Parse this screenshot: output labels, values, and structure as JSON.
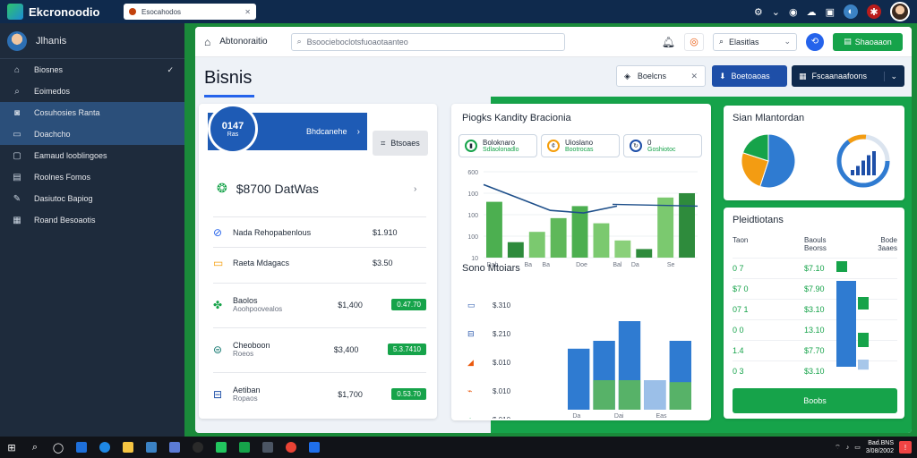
{
  "app": {
    "name": "Ekcronoodio",
    "address_tab": "Esocahodos",
    "title_icons": [
      "gear-icon",
      "chevron-down-icon",
      "help-icon",
      "cloud-icon",
      "folder-icon",
      "theme-icon",
      "grid-icon"
    ]
  },
  "sidebar": {
    "user_name": "Jlhanis",
    "items": [
      {
        "label": "Biosnes",
        "icon": "home-icon",
        "active": false,
        "check": "✓"
      },
      {
        "label": "Eoimedos",
        "icon": "search-icon",
        "active": false
      },
      {
        "label": "Cosuhosies Ranta",
        "icon": "camera-icon",
        "active": true
      },
      {
        "label": "Doachcho",
        "icon": "card-icon",
        "active": true
      },
      {
        "label": "Eamaud looblingoes",
        "icon": "monitor-icon",
        "active": false
      },
      {
        "label": "Roolnes Fomos",
        "icon": "document-icon",
        "active": false
      },
      {
        "label": "Dasiutoc Bapiog",
        "icon": "edit-icon",
        "active": false
      },
      {
        "label": "Roand Besoaotis",
        "icon": "table-icon",
        "active": false
      }
    ]
  },
  "topbar": {
    "breadcrumb": "Abtonoraitio",
    "search_placeholder": "Bsoocieboclotsfuoaotaanteo",
    "select_value": "Elasitlas",
    "action_label": "Shaoaaon"
  },
  "header": {
    "title": "Bisnis",
    "chip_label": "Boelcns",
    "button1_label": "Boetoaoas",
    "button2_label": "Fscaanaafoons"
  },
  "account_card": {
    "badge_value": "0147",
    "badge_sub": "Ras",
    "banner_label": "Bhdcanehe",
    "side_button": "Btsoaes",
    "total_label": "$8700 DatWas",
    "rows": [
      {
        "name": "Nada Rehopabenlous",
        "sub": "",
        "value": "$1.910",
        "pill": "",
        "icon": "link-icon",
        "color": "#2563eb"
      },
      {
        "name": "Raeta Mdagacs",
        "sub": "",
        "value": "$3.50",
        "pill": "",
        "icon": "card-icon",
        "color": "#f59e0b"
      },
      {
        "name": "Baolos",
        "sub": "Aoohpoovealos",
        "value": "$1,400",
        "pill": "0.47.70",
        "icon": "clover-icon",
        "color": "#16a34a"
      },
      {
        "name": "Cheoboon",
        "sub": "Roeos",
        "value": "$3,400",
        "pill": "5.3.7410",
        "icon": "wallet-icon",
        "color": "#0f766e"
      },
      {
        "name": "Aetiban",
        "sub": "Ropaos",
        "value": "$1,700",
        "pill": "0.53.70",
        "icon": "bank-icon",
        "color": "#1e4fa8"
      }
    ]
  },
  "performance_card": {
    "title": "Piogks Kandity Bracionia",
    "chips": [
      {
        "label": "Boloknaro",
        "sub": "Sdlaolonadlo",
        "icon": "chart-icon",
        "color": "green"
      },
      {
        "label": "Uioslano",
        "sub": "Bootrocas",
        "icon": "coin-icon",
        "color": "orange"
      },
      {
        "label": "0",
        "sub": "Goshiotoc",
        "icon": "refresh-icon",
        "color": "blue"
      }
    ],
    "subtitle": "Sono Mtoiars"
  },
  "segment_card": {
    "title": "Sian Mlantordan"
  },
  "positions_card": {
    "title": "Pleidtiotans",
    "columns": [
      "Taon",
      "Baouls",
      "Bode"
    ],
    "col_subs": [
      "",
      "Beorss",
      "3aaes"
    ],
    "rows": [
      {
        "a": "0 7",
        "b": "$7.10"
      },
      {
        "a": "$7 0",
        "b": "$7.90"
      },
      {
        "a": "07 1",
        "b": "$3.10"
      },
      {
        "a": "0 0",
        "b": "13.10"
      },
      {
        "a": "1.4",
        "b": "$7.70"
      },
      {
        "a": "0 3",
        "b": "$3.10"
      }
    ],
    "button_label": "Boobs"
  },
  "taskbar": {
    "clock_time": "Bad.BNS",
    "clock_date": "3/08/2002"
  },
  "chart_data": [
    {
      "type": "bar",
      "categories": [
        "Dab",
        "",
        "Ba",
        "Ba",
        "",
        "Doe",
        "",
        "Bal",
        "Da",
        "",
        "Se",
        ""
      ],
      "series": [
        {
          "values": [
            65,
            18,
            30,
            46,
            60,
            40,
            20,
            10,
            70,
            75
          ]
        }
      ],
      "line": [
        85,
        70,
        55,
        52,
        60
      ],
      "yticks": [
        "600",
        "100",
        "100",
        "100",
        "10"
      ],
      "ylim": [
        0,
        100
      ]
    },
    {
      "type": "bar",
      "categories": [
        "Da",
        "",
        "Dai",
        "",
        "Eas",
        ""
      ],
      "series": [
        {
          "values": [
            62,
            70,
            90,
            30,
            70
          ]
        },
        {
          "values": [
            0,
            30,
            30,
            30,
            28
          ]
        }
      ],
      "row_labels": [
        "$.310",
        "$.210",
        "$.010",
        "$.010",
        "$.010"
      ],
      "row_icons": [
        "card-icon",
        "bank-icon",
        "chart-icon",
        "link-icon",
        "clock-icon"
      ]
    },
    {
      "type": "pie",
      "slices": [
        55,
        25,
        20
      ]
    },
    {
      "type": "bar",
      "series": [
        {
          "values": [
            20,
            35,
            55,
            75,
            90
          ]
        }
      ]
    },
    {
      "type": "bar",
      "series": [
        {
          "values": [
            20,
            90,
            30,
            40,
            60,
            16
          ]
        }
      ]
    }
  ]
}
